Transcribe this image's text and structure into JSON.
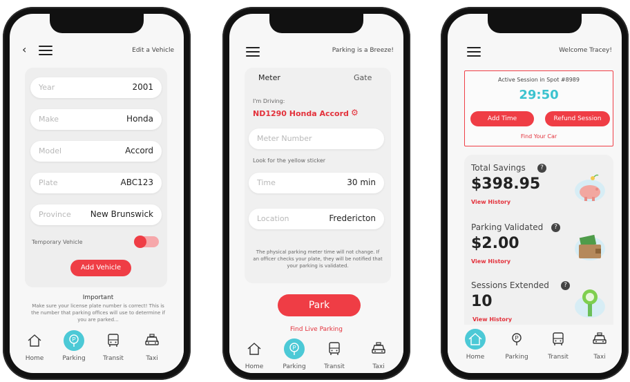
{
  "colors": {
    "accent_red": "#ef3d45",
    "accent_teal": "#4cc9d6"
  },
  "phone1": {
    "header_title": "Edit a Vehicle",
    "fields": [
      {
        "placeholder": "Year",
        "value": "2001"
      },
      {
        "placeholder": "Make",
        "value": "Honda"
      },
      {
        "placeholder": "Model",
        "value": "Accord"
      },
      {
        "placeholder": "Plate",
        "value": "ABC123"
      },
      {
        "placeholder": "Province",
        "value": "New Brunswick"
      }
    ],
    "temp_label": "Temporary Vehicle",
    "temp_on": true,
    "add_button": "Add Vehicle",
    "important_title": "Important",
    "important_text": "Make sure your license plate number is correct! This is the number that parking offices will use to determine if you are parked..."
  },
  "phone2": {
    "header_title": "Parking is a Breeze!",
    "tabs": [
      "Meter",
      "Gate"
    ],
    "driving_label": "I'm Driving:",
    "vehicle": "ND1290 Honda Accord",
    "meter_placeholder": "Meter Number",
    "meter_hint": "Look for the yellow sticker",
    "time": {
      "placeholder": "Time",
      "value": "30 min"
    },
    "location": {
      "placeholder": "Location",
      "value": "Fredericton"
    },
    "notice": "The physical parking meter time will not change. If an officer checks your plate, they will be notified that your parking is validated.",
    "park_button": "Park",
    "find_live": "Find Live Parking"
  },
  "phone3": {
    "header_title": "Welcome Tracey!",
    "session_title": "Active Session in Spot #8989",
    "timer": "29:50",
    "add_time": "Add Time",
    "refund": "Refund Session",
    "find_car": "Find Your Car",
    "stats": [
      {
        "label": "Total Savings",
        "value": "$398.95",
        "link": "View History"
      },
      {
        "label": "Parking Validated",
        "value": "$2.00",
        "link": "View History"
      },
      {
        "label": "Sessions Extended",
        "value": "10",
        "link": "View History"
      }
    ]
  },
  "tabbar": [
    "Home",
    "Parking",
    "Transit",
    "Taxi"
  ]
}
